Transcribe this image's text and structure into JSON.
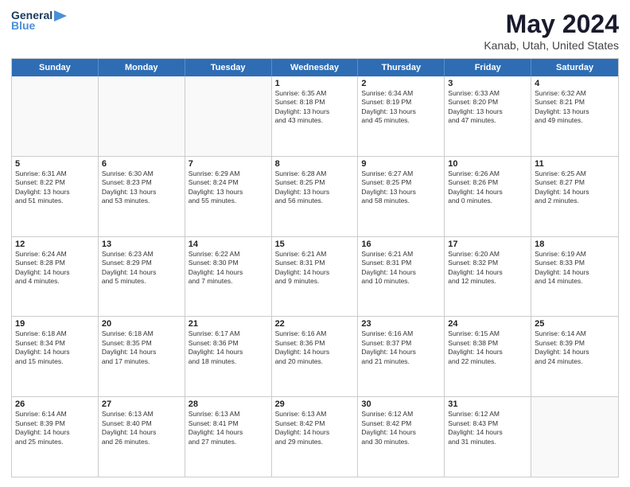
{
  "header": {
    "logo_line1": "General",
    "logo_line2": "Blue",
    "main_title": "May 2024",
    "subtitle": "Kanab, Utah, United States"
  },
  "weekdays": [
    "Sunday",
    "Monday",
    "Tuesday",
    "Wednesday",
    "Thursday",
    "Friday",
    "Saturday"
  ],
  "rows": [
    [
      {
        "day": "",
        "info": ""
      },
      {
        "day": "",
        "info": ""
      },
      {
        "day": "",
        "info": ""
      },
      {
        "day": "1",
        "info": "Sunrise: 6:35 AM\nSunset: 8:18 PM\nDaylight: 13 hours\nand 43 minutes."
      },
      {
        "day": "2",
        "info": "Sunrise: 6:34 AM\nSunset: 8:19 PM\nDaylight: 13 hours\nand 45 minutes."
      },
      {
        "day": "3",
        "info": "Sunrise: 6:33 AM\nSunset: 8:20 PM\nDaylight: 13 hours\nand 47 minutes."
      },
      {
        "day": "4",
        "info": "Sunrise: 6:32 AM\nSunset: 8:21 PM\nDaylight: 13 hours\nand 49 minutes."
      }
    ],
    [
      {
        "day": "5",
        "info": "Sunrise: 6:31 AM\nSunset: 8:22 PM\nDaylight: 13 hours\nand 51 minutes."
      },
      {
        "day": "6",
        "info": "Sunrise: 6:30 AM\nSunset: 8:23 PM\nDaylight: 13 hours\nand 53 minutes."
      },
      {
        "day": "7",
        "info": "Sunrise: 6:29 AM\nSunset: 8:24 PM\nDaylight: 13 hours\nand 55 minutes."
      },
      {
        "day": "8",
        "info": "Sunrise: 6:28 AM\nSunset: 8:25 PM\nDaylight: 13 hours\nand 56 minutes."
      },
      {
        "day": "9",
        "info": "Sunrise: 6:27 AM\nSunset: 8:25 PM\nDaylight: 13 hours\nand 58 minutes."
      },
      {
        "day": "10",
        "info": "Sunrise: 6:26 AM\nSunset: 8:26 PM\nDaylight: 14 hours\nand 0 minutes."
      },
      {
        "day": "11",
        "info": "Sunrise: 6:25 AM\nSunset: 8:27 PM\nDaylight: 14 hours\nand 2 minutes."
      }
    ],
    [
      {
        "day": "12",
        "info": "Sunrise: 6:24 AM\nSunset: 8:28 PM\nDaylight: 14 hours\nand 4 minutes."
      },
      {
        "day": "13",
        "info": "Sunrise: 6:23 AM\nSunset: 8:29 PM\nDaylight: 14 hours\nand 5 minutes."
      },
      {
        "day": "14",
        "info": "Sunrise: 6:22 AM\nSunset: 8:30 PM\nDaylight: 14 hours\nand 7 minutes."
      },
      {
        "day": "15",
        "info": "Sunrise: 6:21 AM\nSunset: 8:31 PM\nDaylight: 14 hours\nand 9 minutes."
      },
      {
        "day": "16",
        "info": "Sunrise: 6:21 AM\nSunset: 8:31 PM\nDaylight: 14 hours\nand 10 minutes."
      },
      {
        "day": "17",
        "info": "Sunrise: 6:20 AM\nSunset: 8:32 PM\nDaylight: 14 hours\nand 12 minutes."
      },
      {
        "day": "18",
        "info": "Sunrise: 6:19 AM\nSunset: 8:33 PM\nDaylight: 14 hours\nand 14 minutes."
      }
    ],
    [
      {
        "day": "19",
        "info": "Sunrise: 6:18 AM\nSunset: 8:34 PM\nDaylight: 14 hours\nand 15 minutes."
      },
      {
        "day": "20",
        "info": "Sunrise: 6:18 AM\nSunset: 8:35 PM\nDaylight: 14 hours\nand 17 minutes."
      },
      {
        "day": "21",
        "info": "Sunrise: 6:17 AM\nSunset: 8:36 PM\nDaylight: 14 hours\nand 18 minutes."
      },
      {
        "day": "22",
        "info": "Sunrise: 6:16 AM\nSunset: 8:36 PM\nDaylight: 14 hours\nand 20 minutes."
      },
      {
        "day": "23",
        "info": "Sunrise: 6:16 AM\nSunset: 8:37 PM\nDaylight: 14 hours\nand 21 minutes."
      },
      {
        "day": "24",
        "info": "Sunrise: 6:15 AM\nSunset: 8:38 PM\nDaylight: 14 hours\nand 22 minutes."
      },
      {
        "day": "25",
        "info": "Sunrise: 6:14 AM\nSunset: 8:39 PM\nDaylight: 14 hours\nand 24 minutes."
      }
    ],
    [
      {
        "day": "26",
        "info": "Sunrise: 6:14 AM\nSunset: 8:39 PM\nDaylight: 14 hours\nand 25 minutes."
      },
      {
        "day": "27",
        "info": "Sunrise: 6:13 AM\nSunset: 8:40 PM\nDaylight: 14 hours\nand 26 minutes."
      },
      {
        "day": "28",
        "info": "Sunrise: 6:13 AM\nSunset: 8:41 PM\nDaylight: 14 hours\nand 27 minutes."
      },
      {
        "day": "29",
        "info": "Sunrise: 6:13 AM\nSunset: 8:42 PM\nDaylight: 14 hours\nand 29 minutes."
      },
      {
        "day": "30",
        "info": "Sunrise: 6:12 AM\nSunset: 8:42 PM\nDaylight: 14 hours\nand 30 minutes."
      },
      {
        "day": "31",
        "info": "Sunrise: 6:12 AM\nSunset: 8:43 PM\nDaylight: 14 hours\nand 31 minutes."
      },
      {
        "day": "",
        "info": ""
      }
    ]
  ]
}
